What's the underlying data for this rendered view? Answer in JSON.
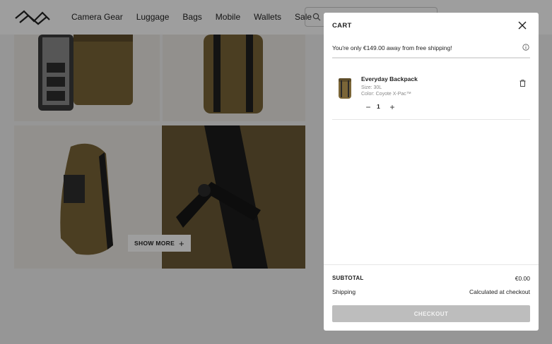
{
  "header": {
    "nav": [
      "Camera Gear",
      "Luggage",
      "Bags",
      "Mobile",
      "Wallets",
      "Sale"
    ],
    "search_placeholder": ""
  },
  "gallery": {
    "show_more_label": "SHOW MORE",
    "show_more_icon": "+"
  },
  "cart": {
    "title": "CART",
    "shipping_note": "You're only €149.00 away from free shipping!",
    "item": {
      "name": "Everyday Backpack",
      "size": "Size: 30L",
      "color": "Color: Coyote X-Pac™",
      "quantity": "1",
      "minus": "−",
      "plus": "+"
    },
    "subtotal_label": "SUBTOTAL",
    "subtotal_value": "€0.00",
    "shipping_label": "Shipping",
    "shipping_value": "Calculated at checkout",
    "checkout_label": "CHECKOUT"
  },
  "colors": {
    "overlay": "#00000061",
    "checkout_disabled": "#bdbdbd",
    "product_coyote": "#7a6538"
  }
}
